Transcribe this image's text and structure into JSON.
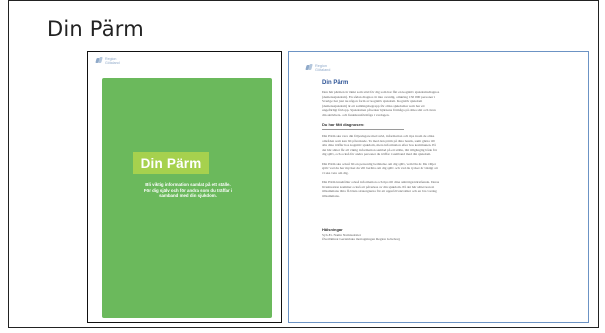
{
  "slide": {
    "title": "Din Pärm"
  },
  "logo": {
    "text": "Region\nGötaland"
  },
  "cover": {
    "title": "Din Pärm",
    "subtitle": "Bli viktig information samlat på ett ställe.\nFör dig själv och för andra som du träffar i\nsamband med din sjukdom.",
    "green": "#6bb95c",
    "title_box_color": "#a6d14e"
  },
  "document": {
    "title": "Din Pärm",
    "intro": "Den här pärmen är tänkt som stöd för dig som har fått en kognitiv sjukdomsdiagnos (demenssjukdom). En sådan diagnos är inte ovanlig, omkring 150 000 personer i Sverige har just nu någon form av kognitiv sjukdom. Kognitiv sjukdom (demenssjukdom) är ett samlingsbegrepp för olika sjukdomar som har ett ungefärligt förlopp. Sjukdomen påverkar hjärnans förmåga på olika sätt och även din aktivitets- och funktionsförmåga i vardagen.",
    "heading": "Du har fått diagnosen:",
    "p2": "Din Pärm ska vara din följeslagare med stöd, information och tips inom de olika områden som kan bli påverkade. Ta med den pärm på dina besök, samt gärna till alla dina träffar hos kognitiv sjukdom, mera information efter hos kommunen. På det här sättet får all viktig information samlad på ett ställe, lätt tillgänglig både för dig själv, och också för andra personer du träffar i samband med din sjukdom.",
    "p3": "Din Pärm ska också bli en personlig berättelse om dig själv, vem Du är. Du väljer själv vad du har mycket du vill berätta om dig själv och vad du tycker är viktigt att vi ska veta om dig.",
    "p4": "Din Pärm innehåller också information och tips till dina anhöriga/närstående. Deras livssituation kommer också att påverkas av din sjukdom. På det här sättet kan ni tillsammans lätta få bästa stratergierna för att uppnå livskvalitet och en bra vardag tillsammans.",
    "contact_heading": "Hälsningar",
    "contact_line1": "Syb-Er. Namn Namnsdotter",
    "contact_line2": "Överlämnat Geriatriska mottagningen Region Göteborg"
  }
}
